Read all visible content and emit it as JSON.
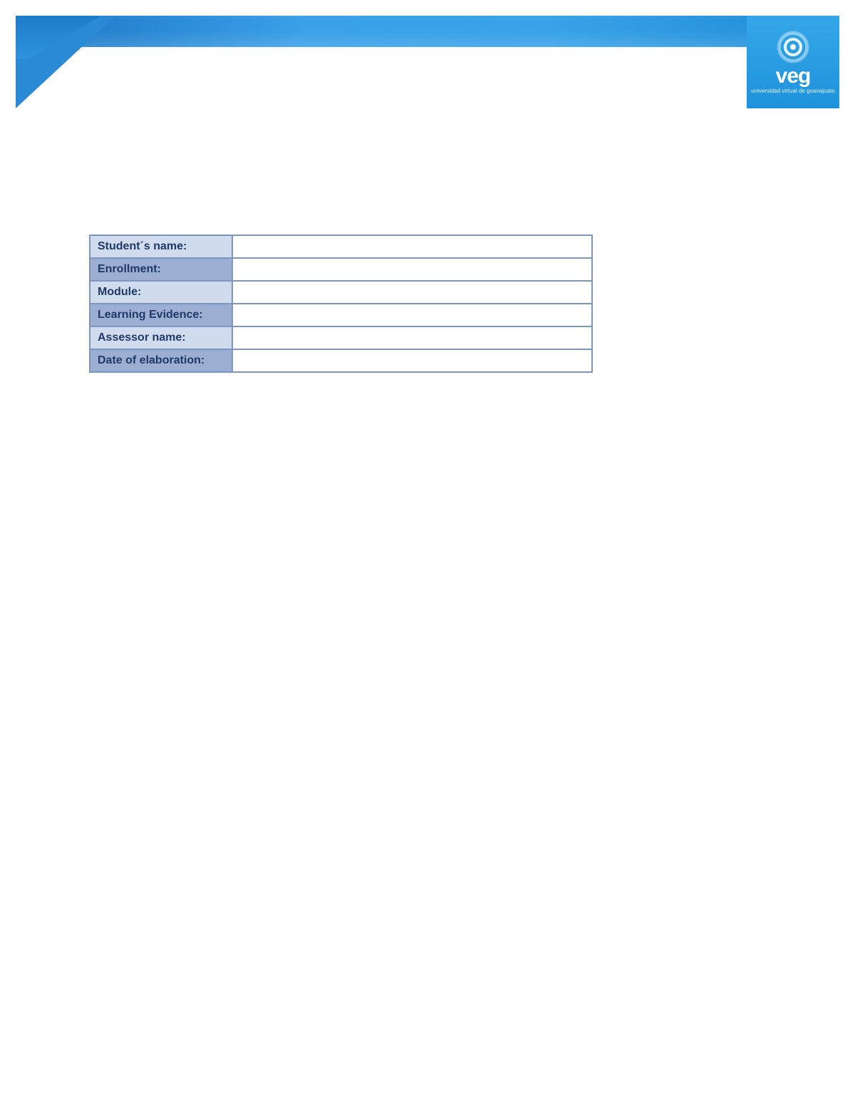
{
  "logo": {
    "text": "veg",
    "subtext": "universidad virtual de guanajuato"
  },
  "form": {
    "rows": [
      {
        "label": "Student´s name:",
        "value": "",
        "shade": "light"
      },
      {
        "label": "Enrollment:",
        "value": "",
        "shade": "dark"
      },
      {
        "label": "Module:",
        "value": "",
        "shade": "light"
      },
      {
        "label": "Learning Evidence:",
        "value": "",
        "shade": "dark"
      },
      {
        "label": "Assessor name:",
        "value": "",
        "shade": "light"
      },
      {
        "label": "Date of elaboration:",
        "value": "",
        "shade": "dark"
      }
    ]
  }
}
